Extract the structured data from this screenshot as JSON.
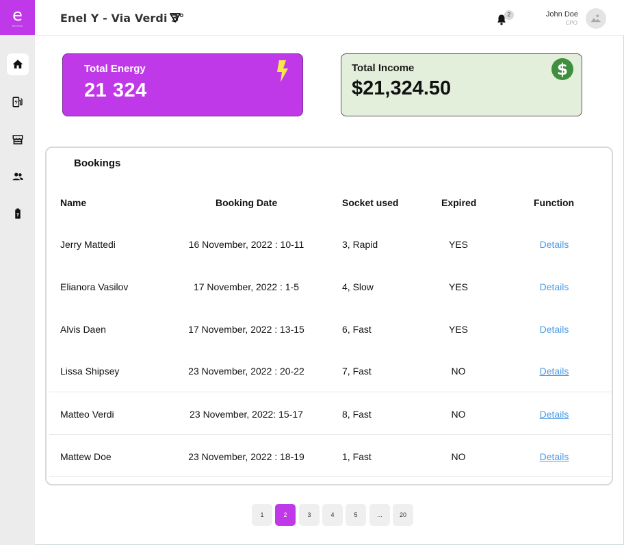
{
  "colors": {
    "brand_purple": "#c039e8",
    "income_green_bg": "#e3efdb",
    "dollar_green": "#3f8f3f",
    "bolt_yellow": "#f5e84a",
    "link_blue": "#4a9be6"
  },
  "sidebar": {
    "logo_letter": "e",
    "logo_subtext": "BOOKING",
    "items": [
      {
        "name": "home",
        "icon": "home-icon",
        "active": true
      },
      {
        "name": "charging",
        "icon": "ev-charger-icon",
        "active": false
      },
      {
        "name": "store",
        "icon": "store-icon",
        "active": false
      },
      {
        "name": "users",
        "icon": "users-icon",
        "active": false
      },
      {
        "name": "battery",
        "icon": "battery-help-icon",
        "active": false
      }
    ]
  },
  "header": {
    "site_title": "Enel Y - Via Verdi 3°",
    "notifications_count": "2",
    "user_name": "John Doe",
    "user_role": "CPO"
  },
  "cards": {
    "energy": {
      "label": "Total Energy",
      "value": "21 324",
      "icon": "lightning-bolt-icon"
    },
    "income": {
      "label": "Total Income",
      "value": "$21,324.50",
      "icon": "dollar-circle-icon"
    }
  },
  "bookings": {
    "title": "Bookings",
    "columns": [
      "Name",
      "Booking Date",
      "Socket used",
      "Expired",
      "Function"
    ],
    "rows": [
      {
        "name": "Jerry Mattedi",
        "date": "16 November, 2022 : 10-11",
        "socket": "3, Rapid",
        "expired": "YES",
        "function": "Details"
      },
      {
        "name": "Elianora Vasilov",
        "date": "17 November, 2022 : 1-5",
        "socket": "4, Slow",
        "expired": "YES",
        "function": "Details"
      },
      {
        "name": "Alvis Daen",
        "date": "17 November, 2022 : 13-15",
        "socket": "6, Fast",
        "expired": "YES",
        "function": "Details"
      },
      {
        "name": "Lissa Shipsey",
        "date": "23 November, 2022 : 20-22",
        "socket": "7, Fast",
        "expired": "NO",
        "function": "Details"
      },
      {
        "name": "Matteo Verdi",
        "date": "23 November, 2022: 15-17",
        "socket": "8, Fast",
        "expired": "NO",
        "function": "Details"
      },
      {
        "name": "Mattew Doe",
        "date": "23 November, 2022 : 18-19",
        "socket": "1, Fast",
        "expired": "NO",
        "function": "Details"
      }
    ]
  },
  "pagination": {
    "pages": [
      "1",
      "2",
      "3",
      "4",
      "5",
      "...",
      "20"
    ],
    "current": "2"
  }
}
